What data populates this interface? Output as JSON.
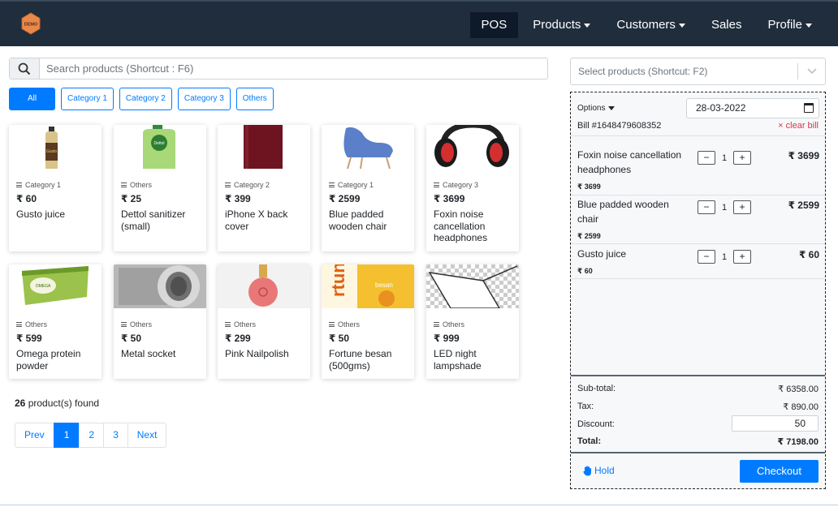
{
  "nav": {
    "brand_text": "DEMO",
    "items": [
      {
        "label": "POS",
        "active": true,
        "dropdown": false
      },
      {
        "label": "Products",
        "active": false,
        "dropdown": true
      },
      {
        "label": "Customers",
        "active": false,
        "dropdown": true
      },
      {
        "label": "Sales",
        "active": false,
        "dropdown": false
      },
      {
        "label": "Profile",
        "active": false,
        "dropdown": true
      }
    ]
  },
  "search": {
    "placeholder": "Search products (Shortcut : F6)",
    "icon": "search-icon"
  },
  "categories": [
    "All",
    "Category 1",
    "Category 2",
    "Category 3",
    "Others"
  ],
  "products": [
    {
      "category": "Category 1",
      "price": "₹ 60",
      "name": "Gusto juice",
      "image": "juice-bottle"
    },
    {
      "category": "Others",
      "price": "₹ 25",
      "name": "Dettol sanitizer (small)",
      "image": "sanitizer-bottle"
    },
    {
      "category": "Category 2",
      "price": "₹ 399",
      "name": "iPhone X back cover",
      "image": "phone-cover"
    },
    {
      "category": "Category 1",
      "price": "₹ 2599",
      "name": "Blue padded wooden chair",
      "image": "blue-chair"
    },
    {
      "category": "Category 3",
      "price": "₹ 3699",
      "name": "Foxin noise cancellation headphones",
      "image": "headphones"
    },
    {
      "category": "Others",
      "price": "₹ 599",
      "name": "Omega protein powder",
      "image": "protein-tub"
    },
    {
      "category": "Others",
      "price": "₹ 50",
      "name": "Metal socket",
      "image": "metal-socket"
    },
    {
      "category": "Others",
      "price": "₹ 299",
      "name": "Pink Nailpolish",
      "image": "nailpolish"
    },
    {
      "category": "Others",
      "price": "₹ 50",
      "name": "Fortune besan (500gms)",
      "image": "besan-pack"
    },
    {
      "category": "Others",
      "price": "₹ 999",
      "name": "LED night lampshade",
      "image": "lampshade"
    }
  ],
  "found": {
    "count": "26",
    "label": "product(s) found"
  },
  "pagination": [
    "Prev",
    "1",
    "2",
    "3",
    "Next"
  ],
  "pagination_active": "1",
  "customer_select": {
    "placeholder": "Select products (Shortcut: F2)"
  },
  "bill": {
    "options_label": "Options",
    "date": "28-03-2022",
    "bill_no": "Bill #1648479608352",
    "clear_label": "× clear bill",
    "items": [
      {
        "name": "Foxin noise cancellation headphones",
        "unit_price": "₹ 3699",
        "qty": "1",
        "total": "₹ 3699"
      },
      {
        "name": "Blue padded wooden chair",
        "unit_price": "₹ 2599",
        "qty": "1",
        "total": "₹ 2599"
      },
      {
        "name": "Gusto juice",
        "unit_price": "₹ 60",
        "qty": "1",
        "total": "₹ 60"
      }
    ],
    "minus": "−",
    "plus": "+",
    "subtotal_label": "Sub-total:",
    "subtotal": "₹ 6358.00",
    "tax_label": "Tax:",
    "tax": "₹ 890.00",
    "discount_label": "Discount:",
    "discount": "50",
    "total_label": "Total:",
    "total": "₹ 7198.00",
    "hold_label": "Hold",
    "checkout_label": "Checkout"
  },
  "colors": {
    "navbar": "#1f2d3d",
    "primary": "#007bff",
    "danger": "#dc3545"
  }
}
